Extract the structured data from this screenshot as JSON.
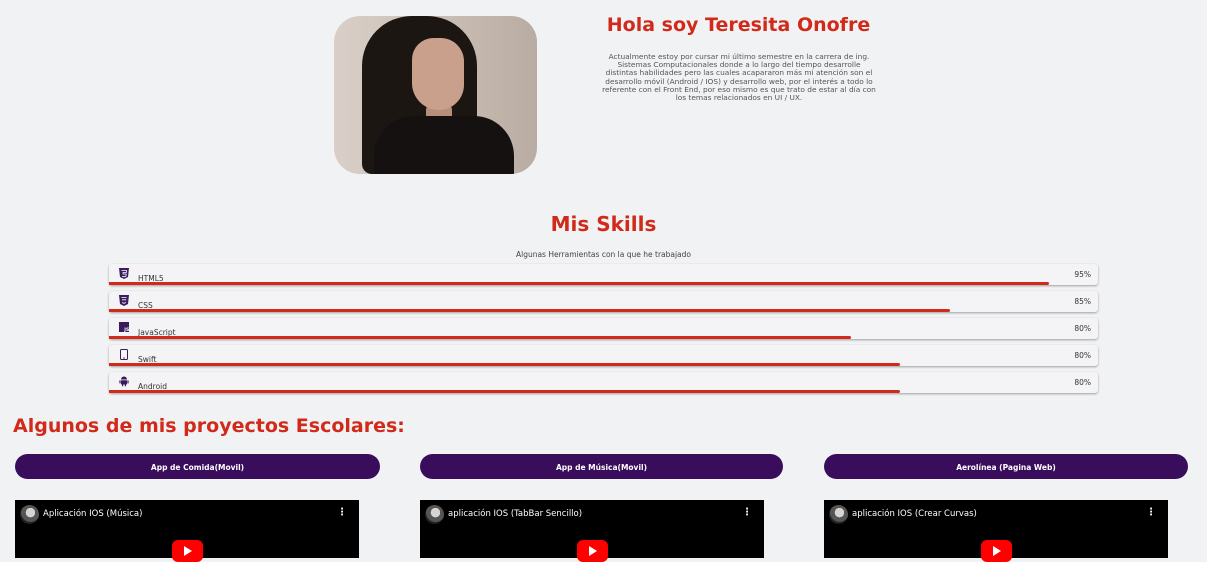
{
  "header": {
    "title": "Hola soy Teresita Onofre",
    "intro": "Actualmente estoy por cursar mi último semestre en la carrera de ing. Sistemas Computacionales donde a lo largo del tiempo desarrolle distintas habilidades pero las cuales acapararon más mi atención son el desarrollo móvil (Android / IOS) y desarrollo web, por el interés a todo lo referente con el Front End, por eso mismo es que trato de estar al día con los temas relacionados en UI / UX."
  },
  "skills": {
    "title": "Mis Skills",
    "subtitle": "Algunas Herramientas con la que he trabajado",
    "bar_color": "#d12a1a",
    "items": [
      {
        "name": "HTML5",
        "percent_label": "95%",
        "fill": 0.95,
        "icon": "html5-icon"
      },
      {
        "name": "CSS",
        "percent_label": "85%",
        "fill": 0.85,
        "icon": "css3-icon"
      },
      {
        "name": "JavaScript",
        "percent_label": "80%",
        "fill": 0.75,
        "icon": "javascript-icon"
      },
      {
        "name": "Swift",
        "percent_label": "80%",
        "fill": 0.8,
        "icon": "mobile-phone-icon"
      },
      {
        "name": "Android",
        "percent_label": "80%",
        "fill": 0.8,
        "icon": "android-icon"
      }
    ]
  },
  "projects": {
    "title": "Algunos de mis proyectos Escolares:",
    "button_color": "#3a0d5c",
    "items": [
      {
        "button": "App de Comida(Movil)",
        "video_title": "Aplicación IOS (Música)"
      },
      {
        "button": "App de Música(Movil)",
        "video_title": "aplicación IOS (TabBar Sencillo)"
      },
      {
        "button": "Aerolínea (Pagina Web)",
        "video_title": "aplicación IOS (Crear Curvas)"
      }
    ]
  }
}
